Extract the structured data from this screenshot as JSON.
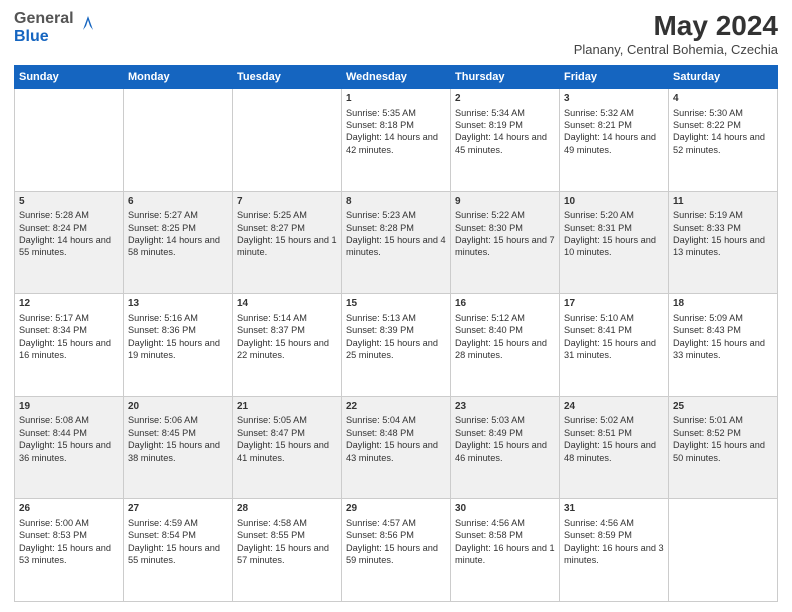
{
  "header": {
    "logo_general": "General",
    "logo_blue": "Blue",
    "month_title": "May 2024",
    "location": "Planany, Central Bohemia, Czechia"
  },
  "days_of_week": [
    "Sunday",
    "Monday",
    "Tuesday",
    "Wednesday",
    "Thursday",
    "Friday",
    "Saturday"
  ],
  "weeks": [
    [
      {
        "day": "",
        "sunrise": "",
        "sunset": "",
        "daylight": ""
      },
      {
        "day": "",
        "sunrise": "",
        "sunset": "",
        "daylight": ""
      },
      {
        "day": "",
        "sunrise": "",
        "sunset": "",
        "daylight": ""
      },
      {
        "day": "1",
        "sunrise": "Sunrise: 5:35 AM",
        "sunset": "Sunset: 8:18 PM",
        "daylight": "Daylight: 14 hours and 42 minutes."
      },
      {
        "day": "2",
        "sunrise": "Sunrise: 5:34 AM",
        "sunset": "Sunset: 8:19 PM",
        "daylight": "Daylight: 14 hours and 45 minutes."
      },
      {
        "day": "3",
        "sunrise": "Sunrise: 5:32 AM",
        "sunset": "Sunset: 8:21 PM",
        "daylight": "Daylight: 14 hours and 49 minutes."
      },
      {
        "day": "4",
        "sunrise": "Sunrise: 5:30 AM",
        "sunset": "Sunset: 8:22 PM",
        "daylight": "Daylight: 14 hours and 52 minutes."
      }
    ],
    [
      {
        "day": "5",
        "sunrise": "Sunrise: 5:28 AM",
        "sunset": "Sunset: 8:24 PM",
        "daylight": "Daylight: 14 hours and 55 minutes."
      },
      {
        "day": "6",
        "sunrise": "Sunrise: 5:27 AM",
        "sunset": "Sunset: 8:25 PM",
        "daylight": "Daylight: 14 hours and 58 minutes."
      },
      {
        "day": "7",
        "sunrise": "Sunrise: 5:25 AM",
        "sunset": "Sunset: 8:27 PM",
        "daylight": "Daylight: 15 hours and 1 minute."
      },
      {
        "day": "8",
        "sunrise": "Sunrise: 5:23 AM",
        "sunset": "Sunset: 8:28 PM",
        "daylight": "Daylight: 15 hours and 4 minutes."
      },
      {
        "day": "9",
        "sunrise": "Sunrise: 5:22 AM",
        "sunset": "Sunset: 8:30 PM",
        "daylight": "Daylight: 15 hours and 7 minutes."
      },
      {
        "day": "10",
        "sunrise": "Sunrise: 5:20 AM",
        "sunset": "Sunset: 8:31 PM",
        "daylight": "Daylight: 15 hours and 10 minutes."
      },
      {
        "day": "11",
        "sunrise": "Sunrise: 5:19 AM",
        "sunset": "Sunset: 8:33 PM",
        "daylight": "Daylight: 15 hours and 13 minutes."
      }
    ],
    [
      {
        "day": "12",
        "sunrise": "Sunrise: 5:17 AM",
        "sunset": "Sunset: 8:34 PM",
        "daylight": "Daylight: 15 hours and 16 minutes."
      },
      {
        "day": "13",
        "sunrise": "Sunrise: 5:16 AM",
        "sunset": "Sunset: 8:36 PM",
        "daylight": "Daylight: 15 hours and 19 minutes."
      },
      {
        "day": "14",
        "sunrise": "Sunrise: 5:14 AM",
        "sunset": "Sunset: 8:37 PM",
        "daylight": "Daylight: 15 hours and 22 minutes."
      },
      {
        "day": "15",
        "sunrise": "Sunrise: 5:13 AM",
        "sunset": "Sunset: 8:39 PM",
        "daylight": "Daylight: 15 hours and 25 minutes."
      },
      {
        "day": "16",
        "sunrise": "Sunrise: 5:12 AM",
        "sunset": "Sunset: 8:40 PM",
        "daylight": "Daylight: 15 hours and 28 minutes."
      },
      {
        "day": "17",
        "sunrise": "Sunrise: 5:10 AM",
        "sunset": "Sunset: 8:41 PM",
        "daylight": "Daylight: 15 hours and 31 minutes."
      },
      {
        "day": "18",
        "sunrise": "Sunrise: 5:09 AM",
        "sunset": "Sunset: 8:43 PM",
        "daylight": "Daylight: 15 hours and 33 minutes."
      }
    ],
    [
      {
        "day": "19",
        "sunrise": "Sunrise: 5:08 AM",
        "sunset": "Sunset: 8:44 PM",
        "daylight": "Daylight: 15 hours and 36 minutes."
      },
      {
        "day": "20",
        "sunrise": "Sunrise: 5:06 AM",
        "sunset": "Sunset: 8:45 PM",
        "daylight": "Daylight: 15 hours and 38 minutes."
      },
      {
        "day": "21",
        "sunrise": "Sunrise: 5:05 AM",
        "sunset": "Sunset: 8:47 PM",
        "daylight": "Daylight: 15 hours and 41 minutes."
      },
      {
        "day": "22",
        "sunrise": "Sunrise: 5:04 AM",
        "sunset": "Sunset: 8:48 PM",
        "daylight": "Daylight: 15 hours and 43 minutes."
      },
      {
        "day": "23",
        "sunrise": "Sunrise: 5:03 AM",
        "sunset": "Sunset: 8:49 PM",
        "daylight": "Daylight: 15 hours and 46 minutes."
      },
      {
        "day": "24",
        "sunrise": "Sunrise: 5:02 AM",
        "sunset": "Sunset: 8:51 PM",
        "daylight": "Daylight: 15 hours and 48 minutes."
      },
      {
        "day": "25",
        "sunrise": "Sunrise: 5:01 AM",
        "sunset": "Sunset: 8:52 PM",
        "daylight": "Daylight: 15 hours and 50 minutes."
      }
    ],
    [
      {
        "day": "26",
        "sunrise": "Sunrise: 5:00 AM",
        "sunset": "Sunset: 8:53 PM",
        "daylight": "Daylight: 15 hours and 53 minutes."
      },
      {
        "day": "27",
        "sunrise": "Sunrise: 4:59 AM",
        "sunset": "Sunset: 8:54 PM",
        "daylight": "Daylight: 15 hours and 55 minutes."
      },
      {
        "day": "28",
        "sunrise": "Sunrise: 4:58 AM",
        "sunset": "Sunset: 8:55 PM",
        "daylight": "Daylight: 15 hours and 57 minutes."
      },
      {
        "day": "29",
        "sunrise": "Sunrise: 4:57 AM",
        "sunset": "Sunset: 8:56 PM",
        "daylight": "Daylight: 15 hours and 59 minutes."
      },
      {
        "day": "30",
        "sunrise": "Sunrise: 4:56 AM",
        "sunset": "Sunset: 8:58 PM",
        "daylight": "Daylight: 16 hours and 1 minute."
      },
      {
        "day": "31",
        "sunrise": "Sunrise: 4:56 AM",
        "sunset": "Sunset: 8:59 PM",
        "daylight": "Daylight: 16 hours and 3 minutes."
      },
      {
        "day": "",
        "sunrise": "",
        "sunset": "",
        "daylight": ""
      }
    ]
  ]
}
